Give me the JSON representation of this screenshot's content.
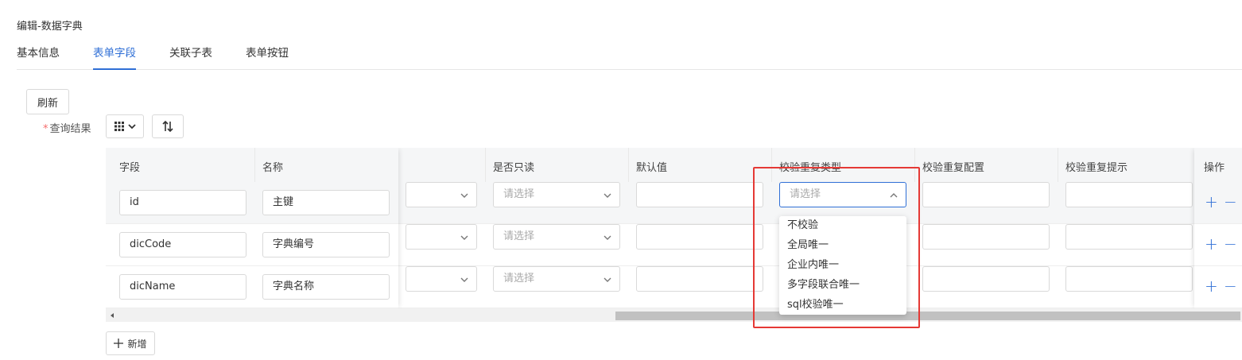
{
  "page": {
    "title": "编辑-数据字典"
  },
  "tabs": [
    {
      "label": "基本信息",
      "active": false
    },
    {
      "label": "表单字段",
      "active": true
    },
    {
      "label": "关联子表",
      "active": false
    },
    {
      "label": "表单按钮",
      "active": false
    }
  ],
  "toolbar": {
    "refresh_label": "刷新",
    "query_label": "查询结果",
    "required_star": "*",
    "add_label": "新增"
  },
  "table": {
    "columns": [
      "字段",
      "名称",
      "是否只读",
      "默认值",
      "校验重复类型",
      "校验重复配置",
      "校验重复提示",
      "操作"
    ],
    "rows": [
      {
        "field": "id",
        "name": "主键",
        "readonly_placeholder": "请选择",
        "dup_type_placeholder": "请选择"
      },
      {
        "field": "dicCode",
        "name": "字典编号",
        "readonly_placeholder": "请选择"
      },
      {
        "field": "dicName",
        "name": "字典名称",
        "readonly_placeholder": "请选择"
      }
    ],
    "op_add": "+",
    "op_remove": "−"
  },
  "dropdown": {
    "options": [
      "不校验",
      "全局唯一",
      "企业内唯一",
      "多字段联合唯一",
      "sql校验唯一"
    ]
  },
  "colors": {
    "accent": "#2f6fd6",
    "highlight": "#e53935"
  }
}
